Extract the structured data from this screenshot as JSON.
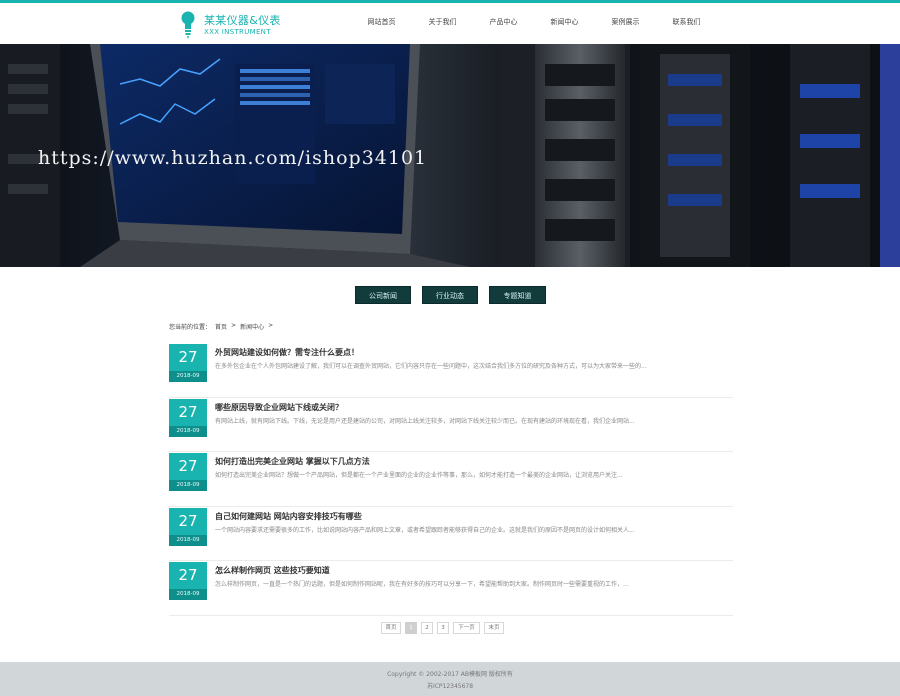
{
  "header": {
    "logo_title": "某某仪器&仪表",
    "logo_sub": "XXX INSTRUMENT",
    "nav": [
      "网站首页",
      "关于我们",
      "产品中心",
      "新闻中心",
      "案例展示",
      "联系我们"
    ]
  },
  "banner": {
    "watermark": "https://www.huzhan.com/ishop34101"
  },
  "categories": [
    "公司新闻",
    "行业动态",
    "专题知道"
  ],
  "breadcrumb": {
    "prefix": "您当前的位置：",
    "home": "首页",
    "sep1": ">",
    "current": "新闻中心",
    "sep2": ">"
  },
  "news": [
    {
      "day": "27",
      "ym": "2018-09",
      "title": "外贸网站建设如何做？需专注什么要点！",
      "summary": "在多外包企业在个人外包网站建设了解，我们可以在调查外贸网站，它们内容只存在一些问题中，这次结合我们多方位的研究及各种方式，可以为大家带来一些的..."
    },
    {
      "day": "27",
      "ym": "2018-09",
      "title": "哪些原因导致企业网站下线或关闭？",
      "summary": "有网站上线，就有网站下线。下线，无论是用户还是建站的公司，对网站上线关注较多，对网站下线关注较少而已。在现有建站的环境现在看，我们企业网站..."
    },
    {
      "day": "27",
      "ym": "2018-09",
      "title": "如何打造出完美企业网站 掌握以下几点方法",
      "summary": "如何打造出完美企业网站？想做一个产品网站，但是都在一个产业里面的企业的企业作等事，那么，如何才能打造一个最美的企业网站，让浏览用户关注..."
    },
    {
      "day": "27",
      "ym": "2018-09",
      "title": "自己如何建网站 网站内容安排技巧有哪些",
      "summary": "一个网站内容要求还需要很多的工作，比如说网站内容产品和网上文章，或者希望跟踪者能够获得自己的企业。这就是我们的原因不是网页的设计如何相关人..."
    },
    {
      "day": "27",
      "ym": "2018-09",
      "title": "怎么样制作网页 这些技巧要知道",
      "summary": "怎么样制作网页，一直是一个热门的话题，但是如何制作网站呢，我在有好多的技巧可以分享一下，希望能帮助到大家。制作网页时一些需要重视的工作，..."
    }
  ],
  "pager": [
    "首页",
    "1",
    "2",
    "3",
    "下一页",
    "末页"
  ],
  "footer": {
    "copyright": "Copyright © 2002-2017 AB模板网 版权所有",
    "icp": "苏ICP12345678"
  }
}
